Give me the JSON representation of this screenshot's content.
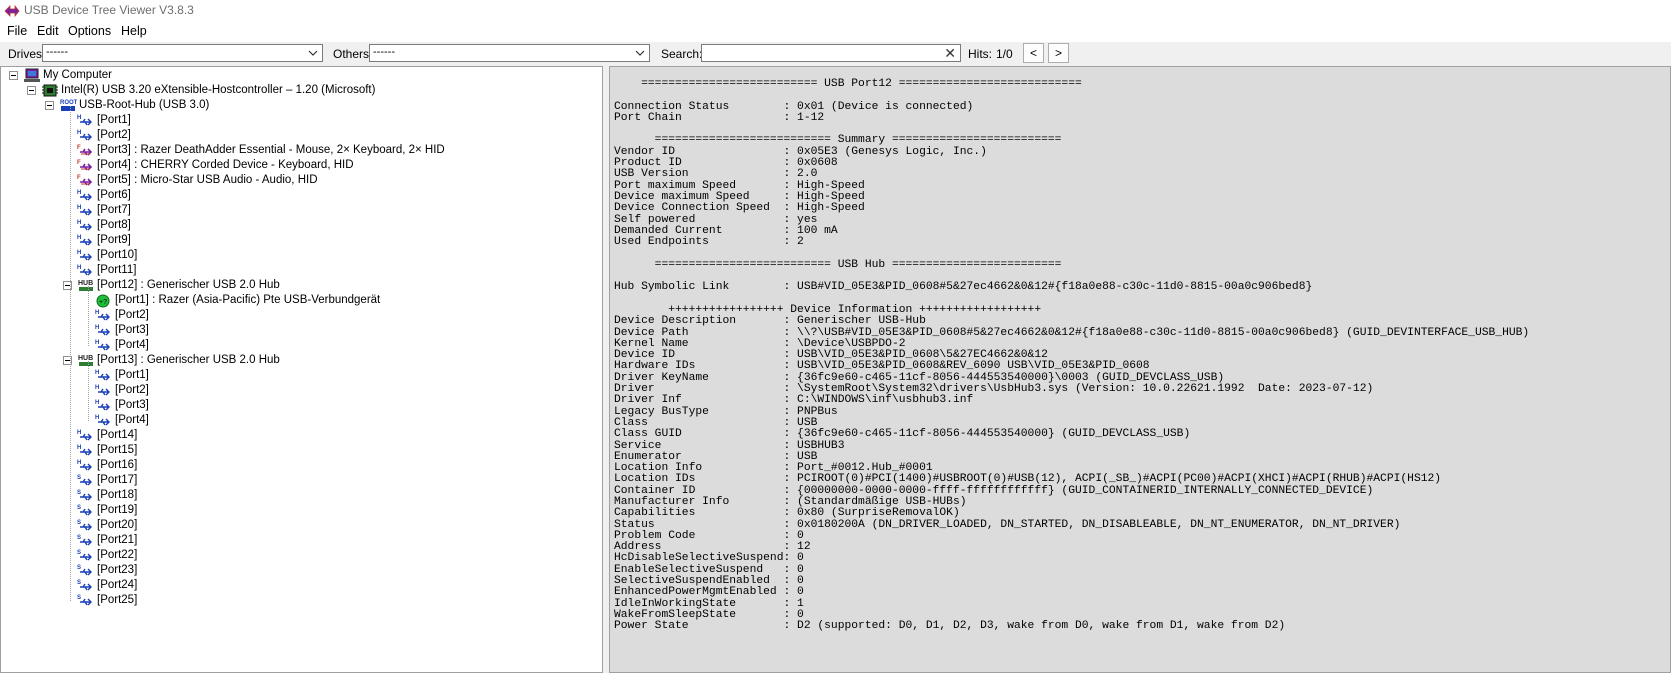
{
  "window": {
    "title": "USB Device Tree Viewer V3.8.3"
  },
  "menu": [
    "File",
    "Edit",
    "Options",
    "Help"
  ],
  "toolbar": {
    "drives_label": "Drives:",
    "drives_value": "------",
    "others_label": "Others:",
    "others_value": "------",
    "search_label": "Search:",
    "search_value": "",
    "clear_glyph": "✕",
    "hits_label": "Hits:",
    "hits_value": "1/0",
    "prev_glyph": "<",
    "next_glyph": ">"
  },
  "tree": {
    "root": "My Computer",
    "controller": "Intel(R) USB 3.20 eXtensible-Hostcontroller – 1.20 (Microsoft)",
    "roothub": "USB-Root-Hub (USB 3.0)",
    "root_ports": [
      {
        "label": "[Port1]",
        "icon": "usb-empty-port-icon"
      },
      {
        "label": "[Port2]",
        "icon": "usb-empty-port-icon"
      },
      {
        "label": "[Port3] : Razer DeathAdder Essential - Mouse, 2× Keyboard, 2× HID",
        "icon": "usb-device-port-icon"
      },
      {
        "label": "[Port4] : CHERRY Corded Device - Keyboard, HID",
        "icon": "usb-device-port-icon"
      },
      {
        "label": "[Port5] : Micro-Star USB Audio - Audio, HID",
        "icon": "usb-device-port-icon"
      },
      {
        "label": "[Port6]",
        "icon": "usb-empty-port-icon"
      },
      {
        "label": "[Port7]",
        "icon": "usb-empty-port-icon"
      },
      {
        "label": "[Port8]",
        "icon": "usb-empty-port-icon"
      },
      {
        "label": "[Port9]",
        "icon": "usb-empty-port-icon"
      },
      {
        "label": "[Port10]",
        "icon": "usb-empty-port-icon"
      },
      {
        "label": "[Port11]",
        "icon": "usb-empty-port-icon"
      }
    ],
    "hub12": "[Port12] : Generischer USB 2.0 Hub",
    "hub12_ports": [
      {
        "label": "[Port1] : Razer (Asia-Pacific) Pte USB-Verbundgerät",
        "icon": "green-device-icon"
      },
      {
        "label": "[Port2]",
        "icon": "usb-empty-port-icon"
      },
      {
        "label": "[Port3]",
        "icon": "usb-empty-port-icon"
      },
      {
        "label": "[Port4]",
        "icon": "usb-empty-port-icon"
      }
    ],
    "hub13": "[Port13] : Generischer USB 2.0 Hub",
    "hub13_ports": [
      {
        "label": "[Port1]",
        "icon": "usb-empty-port-icon"
      },
      {
        "label": "[Port2]",
        "icon": "usb-empty-port-icon"
      },
      {
        "label": "[Port3]",
        "icon": "usb-empty-port-icon"
      },
      {
        "label": "[Port4]",
        "icon": "usb-empty-port-icon"
      }
    ],
    "tail_ports": [
      {
        "label": "[Port14]",
        "icon": "usb-empty-port-icon"
      },
      {
        "label": "[Port15]",
        "icon": "usb-empty-port-icon"
      },
      {
        "label": "[Port16]",
        "icon": "usb-empty-port-icon"
      },
      {
        "label": "[Port17]",
        "icon": "usb-ss-port-icon"
      },
      {
        "label": "[Port18]",
        "icon": "usb-ss-port-icon"
      },
      {
        "label": "[Port19]",
        "icon": "usb-ss-port-icon"
      },
      {
        "label": "[Port20]",
        "icon": "usb-ss-port-icon"
      },
      {
        "label": "[Port21]",
        "icon": "usb-ss-port-icon"
      },
      {
        "label": "[Port22]",
        "icon": "usb-ss-port-icon"
      },
      {
        "label": "[Port23]",
        "icon": "usb-ss-port-icon"
      },
      {
        "label": "[Port24]",
        "icon": "usb-ss-port-icon"
      },
      {
        "label": "[Port25]",
        "icon": "usb-ss-port-icon"
      }
    ]
  },
  "detail_lines": [
    "    ========================== USB Port12 ===========================",
    "",
    "Connection Status        : 0x01 (Device is connected)",
    "Port Chain               : 1-12",
    "",
    "      ========================== Summary =========================",
    "Vendor ID                : 0x05E3 (Genesys Logic, Inc.)",
    "Product ID               : 0x0608",
    "USB Version              : 2.0",
    "Port maximum Speed       : High-Speed",
    "Device maximum Speed     : High-Speed",
    "Device Connection Speed  : High-Speed",
    "Self powered             : yes",
    "Demanded Current         : 100 mA",
    "Used Endpoints           : 2",
    "",
    "      ========================== USB Hub =========================",
    "",
    "Hub Symbolic Link        : USB#VID_05E3&PID_0608#5&27ec4662&0&12#{f18a0e88-c30c-11d0-8815-00a0c906bed8}",
    "",
    "        +++++++++++++++++ Device Information ++++++++++++++++++",
    "Device Description       : Generischer USB-Hub",
    "Device Path              : \\\\?\\USB#VID_05E3&PID_0608#5&27ec4662&0&12#{f18a0e88-c30c-11d0-8815-00a0c906bed8} (GUID_DEVINTERFACE_USB_HUB)",
    "Kernel Name              : \\Device\\USBPDO-2",
    "Device ID                : USB\\VID_05E3&PID_0608\\5&27EC4662&0&12",
    "Hardware IDs             : USB\\VID_05E3&PID_0608&REV_6090 USB\\VID_05E3&PID_0608",
    "Driver KeyName           : {36fc9e60-c465-11cf-8056-444553540000}\\0003 (GUID_DEVCLASS_USB)",
    "Driver                   : \\SystemRoot\\System32\\drivers\\UsbHub3.sys (Version: 10.0.22621.1992  Date: 2023-07-12)",
    "Driver Inf               : C:\\WINDOWS\\inf\\usbhub3.inf",
    "Legacy BusType           : PNPBus",
    "Class                    : USB",
    "Class GUID               : {36fc9e60-c465-11cf-8056-444553540000} (GUID_DEVCLASS_USB)",
    "Service                  : USBHUB3",
    "Enumerator               : USB",
    "Location Info            : Port_#0012.Hub_#0001",
    "Location IDs             : PCIROOT(0)#PCI(1400)#USBROOT(0)#USB(12), ACPI(_SB_)#ACPI(PC00)#ACPI(XHCI)#ACPI(RHUB)#ACPI(HS12)",
    "Container ID             : {00000000-0000-0000-ffff-ffffffffffff} (GUID_CONTAINERID_INTERNALLY_CONNECTED_DEVICE)",
    "Manufacturer Info        : (Standardmäßige USB-HUBs)",
    "Capabilities             : 0x80 (SurpriseRemovalOK)",
    "Status                   : 0x0180200A (DN_DRIVER_LOADED, DN_STARTED, DN_DISABLEABLE, DN_NT_ENUMERATOR, DN_NT_DRIVER)",
    "Problem Code             : 0",
    "Address                  : 12",
    "HcDisableSelectiveSuspend: 0",
    "EnableSelectiveSuspend   : 0",
    "SelectiveSuspendEnabled  : 0",
    "EnhancedPowerMgmtEnabled : 0",
    "IdleInWorkingState       : 1",
    "WakeFromSleepState       : 0",
    "Power State              : D2 (supported: D0, D1, D2, D3, wake from D0, wake from D1, wake from D2)"
  ]
}
